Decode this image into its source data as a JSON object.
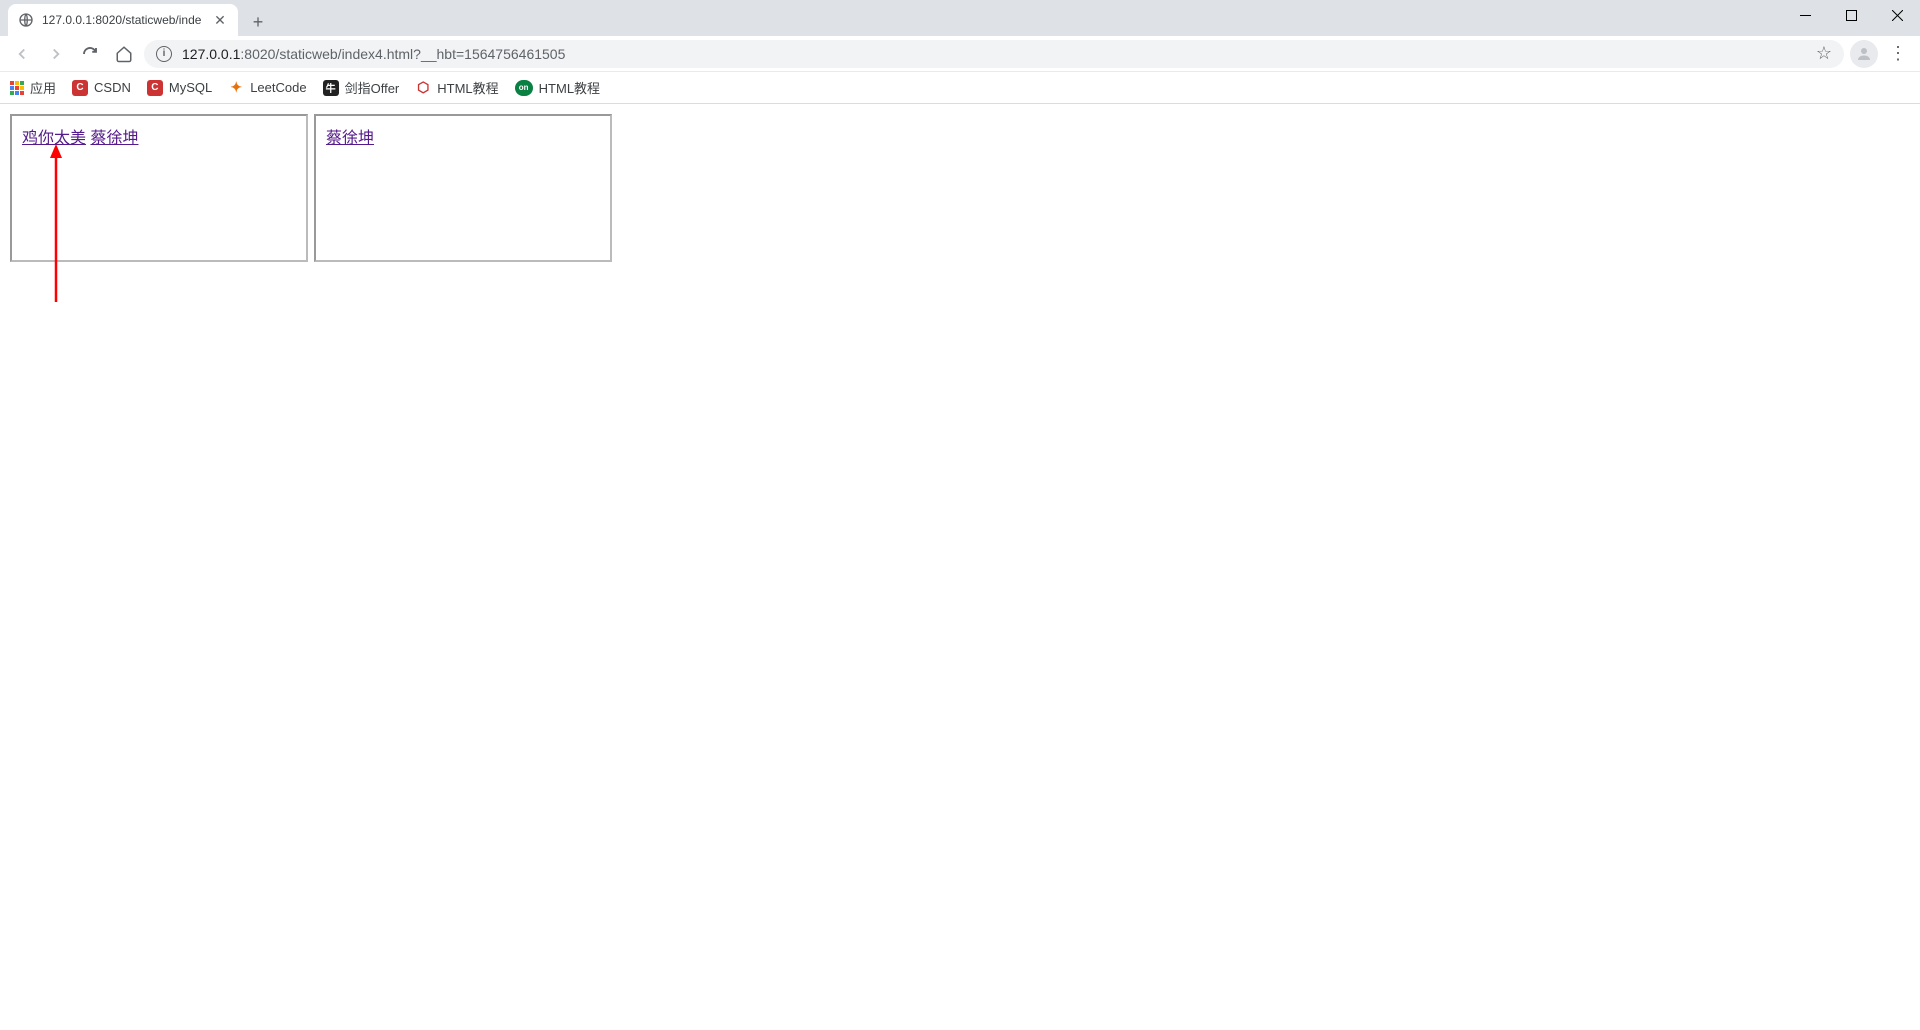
{
  "tab": {
    "title": "127.0.0.1:8020/staticweb/inde"
  },
  "url": {
    "host": "127.0.0.1",
    "path": ":8020/staticweb/index4.html?__hbt=1564756461505"
  },
  "bookmarks": {
    "apps": "应用",
    "items": [
      {
        "label": "CSDN"
      },
      {
        "label": "MySQL"
      },
      {
        "label": "LeetCode"
      },
      {
        "label": "剑指Offer"
      },
      {
        "label": "HTML教程"
      },
      {
        "label": "HTML教程"
      }
    ]
  },
  "content": {
    "boxes": [
      {
        "links": [
          "鸡你太美",
          "蔡徐坤"
        ]
      },
      {
        "links": [
          "蔡徐坤"
        ]
      }
    ]
  }
}
